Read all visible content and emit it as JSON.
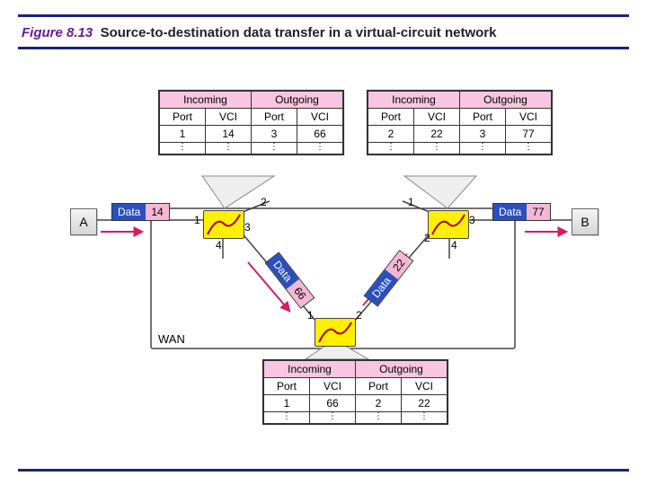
{
  "caption": {
    "fig_prefix": "Figure",
    "fig_num": "8.13",
    "title": "Source-to-destination data transfer in a virtual-circuit network"
  },
  "hosts": {
    "left": "A",
    "right": "B"
  },
  "wan_label": "WAN",
  "headers": {
    "incoming": "Incoming",
    "outgoing": "Outgoing",
    "port": "Port",
    "vci": "VCI"
  },
  "tables": {
    "topLeft": {
      "rows": [
        {
          "in_port": "1",
          "in_vci": "14",
          "out_port": "3",
          "out_vci": "66"
        }
      ]
    },
    "topRight": {
      "rows": [
        {
          "in_port": "2",
          "in_vci": "22",
          "out_port": "3",
          "out_vci": "77"
        }
      ]
    },
    "bottom": {
      "rows": [
        {
          "in_port": "1",
          "in_vci": "66",
          "out_port": "2",
          "out_vci": "22"
        }
      ]
    }
  },
  "packets": {
    "aOut": {
      "data": "Data",
      "vci": "14"
    },
    "bIn": {
      "data": "Data",
      "vci": "77"
    },
    "leftDown": {
      "data": "Data",
      "vci": "66"
    },
    "rightUp": {
      "data": "Data",
      "vci": "22"
    }
  },
  "ports": {
    "switchL": {
      "p1": "1",
      "p2": "2",
      "p3": "3",
      "p4": "4"
    },
    "switchR": {
      "p1": "1",
      "p2": "2",
      "p3": "3",
      "p4": "4"
    },
    "switchB": {
      "p1": "1",
      "p2": "2"
    }
  }
}
